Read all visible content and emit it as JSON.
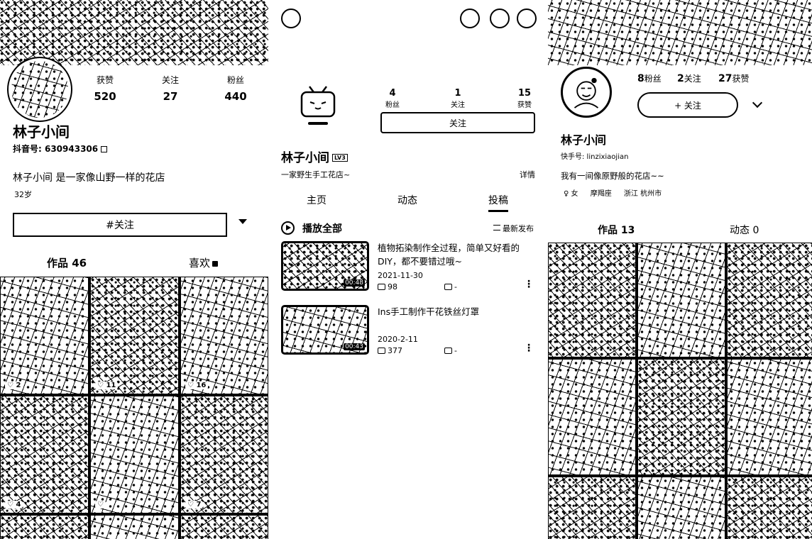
{
  "douyin": {
    "stats": [
      {
        "label": "获赞",
        "value": "520"
      },
      {
        "label": "关注",
        "value": "27"
      },
      {
        "label": "粉丝",
        "value": "440"
      }
    ],
    "name": "林子小间",
    "id_text": "抖音号: 630943306",
    "bio": "林子小间 是一家像山野一样的花店",
    "age": "32岁",
    "follow_button": "#关注",
    "tabs": [
      {
        "label": "作品 46"
      },
      {
        "label": "喜欢"
      }
    ],
    "grid_likes": [
      "2",
      "11",
      "16",
      "4",
      "",
      "7"
    ]
  },
  "bilibili": {
    "stats": [
      {
        "value": "4",
        "label": "粉丝"
      },
      {
        "value": "1",
        "label": "关注"
      },
      {
        "value": "15",
        "label": "获赞"
      }
    ],
    "follow_button": "关注",
    "name": "林子小间",
    "level_badge": "LV3",
    "sign": "一家野生手工花店~",
    "detail_link": "详情",
    "tabs": [
      {
        "label": "主页",
        "active": false
      },
      {
        "label": "动态",
        "active": false
      },
      {
        "label": "投稿",
        "active": true
      }
    ],
    "play_all": "播放全部",
    "sort": "最新发布",
    "videos": [
      {
        "title": "植物拓染制作全过程，简单又好看的DIY，都不要错过哦~",
        "duration": "00:48",
        "date": "2021-11-30",
        "plays": "98",
        "comments": "-"
      },
      {
        "title": "Ins手工制作干花铁丝灯罩",
        "duration": "00:43",
        "date": "2020-2-11",
        "plays": "377",
        "comments": "-"
      }
    ]
  },
  "kuaishou": {
    "stats": [
      {
        "value": "8",
        "label": "粉丝"
      },
      {
        "value": "2",
        "label": "关注"
      },
      {
        "value": "27",
        "label": "获赞"
      }
    ],
    "follow_button": "+ 关注",
    "name": "林子小间",
    "id_text": "快手号: linzixiaojian",
    "bio": "我有一间像原野般的花店~~",
    "tags": [
      "♀ 女",
      "摩羯座",
      "浙江 杭州市"
    ],
    "tabs": [
      {
        "label": "作品 13"
      },
      {
        "label": "动态 0"
      }
    ]
  }
}
